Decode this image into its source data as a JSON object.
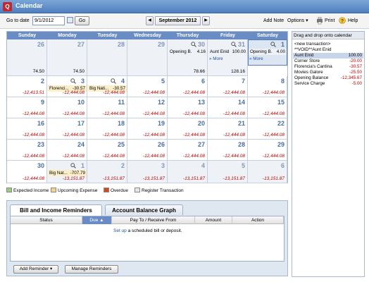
{
  "window": {
    "title": "Calendar",
    "app_icon_letter": "Q"
  },
  "toolbar": {
    "goto_label": "Go to date",
    "goto_value": "9/1/2012",
    "go_button": "Go",
    "month": "September 2012",
    "prev_glyph": "◀",
    "next_glyph": "▶",
    "add_note": "Add Note",
    "options": "Options ▾",
    "print": "Print",
    "help": "Help"
  },
  "days": [
    "Sunday",
    "Monday",
    "Tuesday",
    "Wednesday",
    "Thursday",
    "Friday",
    "Saturday"
  ],
  "weeks": [
    [
      {
        "d": "26",
        "dim": true,
        "bal": ""
      },
      {
        "d": "27",
        "dim": true,
        "bal": ""
      },
      {
        "d": "28",
        "dim": true,
        "bal": ""
      },
      {
        "d": "29",
        "dim": true,
        "bal": ""
      },
      {
        "d": "30",
        "dim": true,
        "zoom": true,
        "bal": "78.66",
        "pos": true,
        "events": [
          {
            "name": "Opening B...",
            "amt": "4.16",
            "style": "plain"
          }
        ]
      },
      {
        "d": "31",
        "dim": true,
        "zoom": true,
        "bal": "128.16",
        "pos": true,
        "events": [
          {
            "name": "Aunt Enid",
            "amt": "100.00",
            "style": "plain"
          }
        ],
        "more": "» More"
      },
      {
        "d": "1",
        "sel": true,
        "zoom": true,
        "bal": "",
        "events": [
          {
            "name": "Opening B...",
            "amt": "4.00",
            "style": "plain"
          }
        ],
        "more": "» More"
      }
    ],
    [
      {
        "d": "",
        "dim": true,
        "bal": "74.50",
        "pos": true,
        "extra": true
      },
      {
        "d": "",
        "dim": true,
        "bal": "74.50",
        "pos": true,
        "extra": true
      },
      {
        "d": "",
        "dim": true,
        "bal": "",
        "extra": true
      },
      {
        "d": "",
        "dim": true,
        "bal": "",
        "extra": true
      }
    ],
    [
      {
        "d": "2",
        "bal": "-12,413.51"
      },
      {
        "d": "3",
        "zoom": true,
        "bal": "-12,444.08",
        "events": [
          {
            "name": "Florenci...",
            "amt": "-30.57",
            "style": "exp"
          }
        ]
      },
      {
        "d": "4",
        "zoom": true,
        "bal": "-12,444.08",
        "events": [
          {
            "name": "Big Nati...",
            "amt": "-30.57",
            "style": "exp"
          }
        ]
      },
      {
        "d": "5",
        "bal": "-12,444.08"
      },
      {
        "d": "6",
        "bal": "-12,444.08"
      },
      {
        "d": "7",
        "bal": "-12,444.08"
      },
      {
        "d": "8",
        "bal": "-12,444.08"
      }
    ],
    [
      {
        "d": "9",
        "bal": "-12,444.08"
      },
      {
        "d": "10",
        "bal": "-12,444.08"
      },
      {
        "d": "11",
        "bal": "-12,444.08"
      },
      {
        "d": "12",
        "bal": "-12,444.08"
      },
      {
        "d": "13",
        "bal": "-12,444.08"
      },
      {
        "d": "14",
        "bal": "-12,444.08"
      },
      {
        "d": "15",
        "bal": "-12,444.08"
      }
    ],
    [
      {
        "d": "16",
        "bal": "-12,444.08"
      },
      {
        "d": "17",
        "bal": "-12,444.08"
      },
      {
        "d": "18",
        "bal": "-12,444.08"
      },
      {
        "d": "19",
        "bal": "-12,444.08"
      },
      {
        "d": "20",
        "bal": "-12,444.08"
      },
      {
        "d": "21",
        "bal": "-12,444.08"
      },
      {
        "d": "22",
        "bal": "-12,444.08"
      }
    ],
    [
      {
        "d": "23",
        "bal": "-12,444.08"
      },
      {
        "d": "24",
        "bal": "-12,444.08"
      },
      {
        "d": "25",
        "bal": "-12,444.08"
      },
      {
        "d": "26",
        "bal": "-12,444.08"
      },
      {
        "d": "27",
        "bal": "-12,444.08"
      },
      {
        "d": "28",
        "bal": "-12,444.08"
      },
      {
        "d": "29",
        "bal": "-12,444.08"
      }
    ],
    [
      {
        "d": "30",
        "bal": "-12,444.08"
      },
      {
        "d": "1",
        "dim": true,
        "zoom": true,
        "bal": "-13,151.87",
        "events": [
          {
            "name": "Big Nat...",
            "amt": "-707.79",
            "style": "exp"
          }
        ]
      },
      {
        "d": "2",
        "dim": true,
        "bal": "-13,151.87"
      },
      {
        "d": "3",
        "dim": true,
        "bal": "-13,151.87"
      },
      {
        "d": "4",
        "dim": true,
        "bal": "-13,151.87"
      },
      {
        "d": "5",
        "dim": true,
        "bal": "-13,151.87"
      },
      {
        "d": "6",
        "dim": true,
        "bal": "-13,151.87"
      }
    ]
  ],
  "legend": [
    {
      "label": "Expected Income",
      "color": "#9dc97a"
    },
    {
      "label": "Upcoming Expense",
      "color": "#f2d58a"
    },
    {
      "label": "Overdue",
      "color": "#d24a1f"
    },
    {
      "label": "Register Transaction",
      "color": "#e6e6e6"
    }
  ],
  "panel": {
    "tab_bills": "Bill and Income Reminders",
    "tab_graph": "Account Balance Graph",
    "columns": [
      "Status",
      "Due ▲",
      "Pay To / Receive From",
      "Amount",
      "Action"
    ],
    "empty_link": "Set up",
    "empty_rest": " a scheduled bill or deposit.",
    "add_reminder": "Add Reminder ▾",
    "manage_reminders": "Manage Reminders"
  },
  "sidebar": {
    "header": "Drag and drop onto calendar",
    "payees": [
      {
        "name": "<new transaction>",
        "amt": "",
        "neg": false
      },
      {
        "name": "**VOID**Aunt Enid",
        "amt": "",
        "neg": false
      },
      {
        "name": "Aunt Enid",
        "amt": "100.00",
        "neg": false,
        "hl": true
      },
      {
        "name": "Corner Store",
        "amt": "-20.00",
        "neg": true
      },
      {
        "name": "Florencia's Cantina",
        "amt": "-30.57",
        "neg": true
      },
      {
        "name": "Movies Galore",
        "amt": "-25.50",
        "neg": true
      },
      {
        "name": "Opening Balance",
        "amt": "-12,345.67",
        "neg": true
      },
      {
        "name": "Service Charge",
        "amt": "-5.00",
        "neg": true
      }
    ]
  },
  "colors": {
    "header_blue": "#6a8cc4",
    "negative": "#c00000",
    "link": "#1f4f9c"
  }
}
